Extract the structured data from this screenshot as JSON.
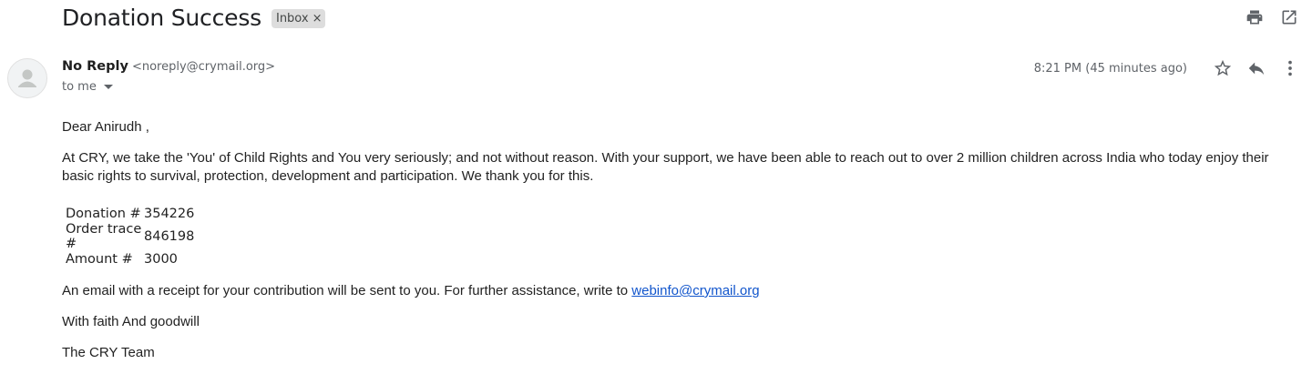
{
  "email": {
    "subject": "Donation Success",
    "label": "Inbox",
    "label_remove": "×",
    "sender_name": "No Reply",
    "sender_email": "<noreply@crymail.org>",
    "to": "to me",
    "timestamp": "8:21 PM (45 minutes ago)"
  },
  "body": {
    "greeting": "Dear Anirudh ,",
    "paragraph1": "At CRY, we take the 'You' of Child Rights and You very seriously; and not without reason. With your support, we have been able to reach out to over 2 million children across India who today enjoy their basic rights to survival, protection, development and participation. We thank you for this.",
    "details": [
      {
        "label": "Donation #",
        "value": "354226"
      },
      {
        "label": "Order trace #",
        "value": "846198"
      },
      {
        "label": "Amount #",
        "value": "3000"
      }
    ],
    "paragraph2": "An email with a receipt for your contribution will be sent to you. For further assistance, write to",
    "link": "webinfo@crymail.org",
    "closing": "With faith And goodwill",
    "signature": "The CRY Team"
  },
  "icons": {
    "top": [
      "print-icon",
      "open-in-new-window-icon"
    ],
    "meta": [
      "star-icon",
      "reply-icon",
      "more-vertical-icon"
    ]
  },
  "colors": {
    "link": "#1155cc",
    "label_chip_bg": "#dddddd",
    "secondary_text": "#5f6368"
  }
}
